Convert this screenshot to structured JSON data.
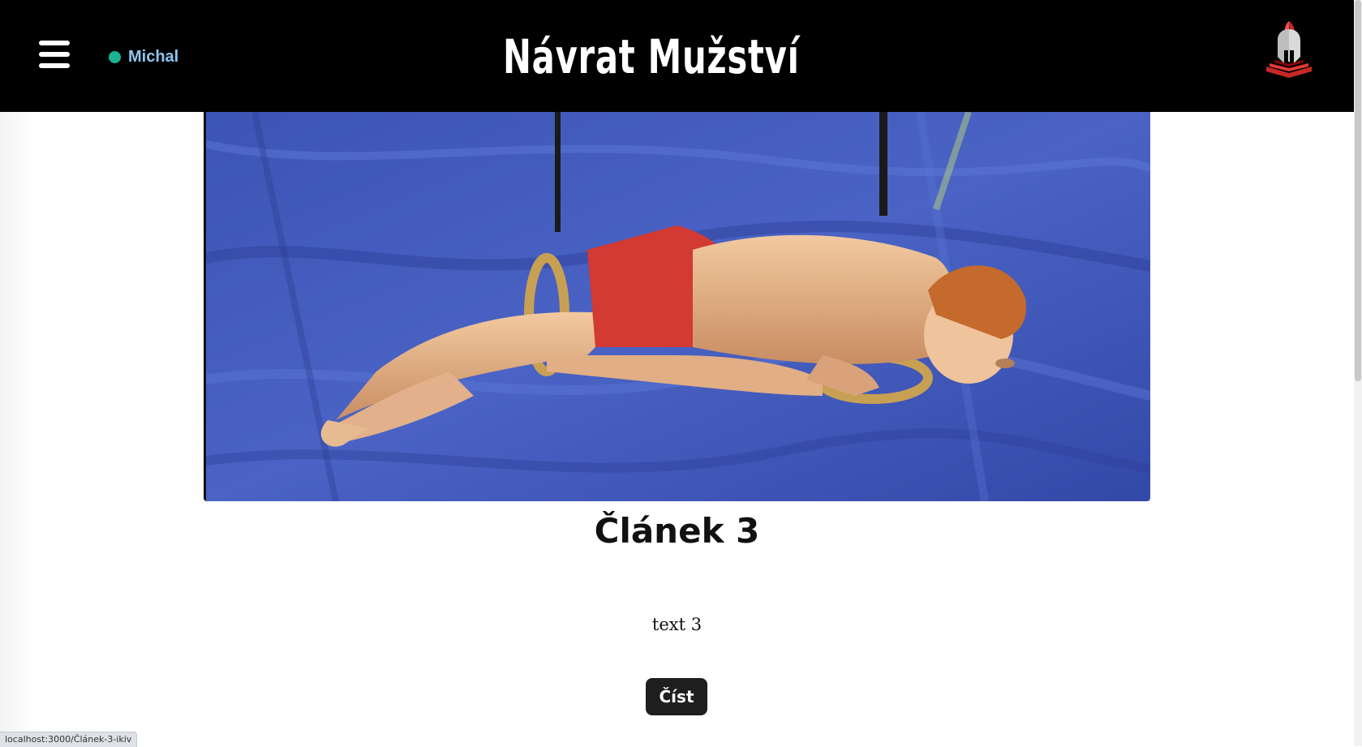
{
  "header": {
    "site_title": "Návrat Mužství",
    "user": {
      "name": "Michal",
      "status_color": "#1ab394"
    },
    "menu_icon": "hamburger-menu-icon",
    "logo_icon": "spartan-helmet-logo"
  },
  "article": {
    "title": "Článek 3",
    "text": "text 3",
    "read_button_label": "Číst",
    "image_alt": "gymnast on rings"
  },
  "status_bar": {
    "url": "localhost:3000/Článek-3-ikiv"
  },
  "colors": {
    "navbar_bg": "#000000",
    "user_name": "#8ec5f0",
    "button_bg": "#1e1e1e",
    "logo_red": "#c62828"
  }
}
